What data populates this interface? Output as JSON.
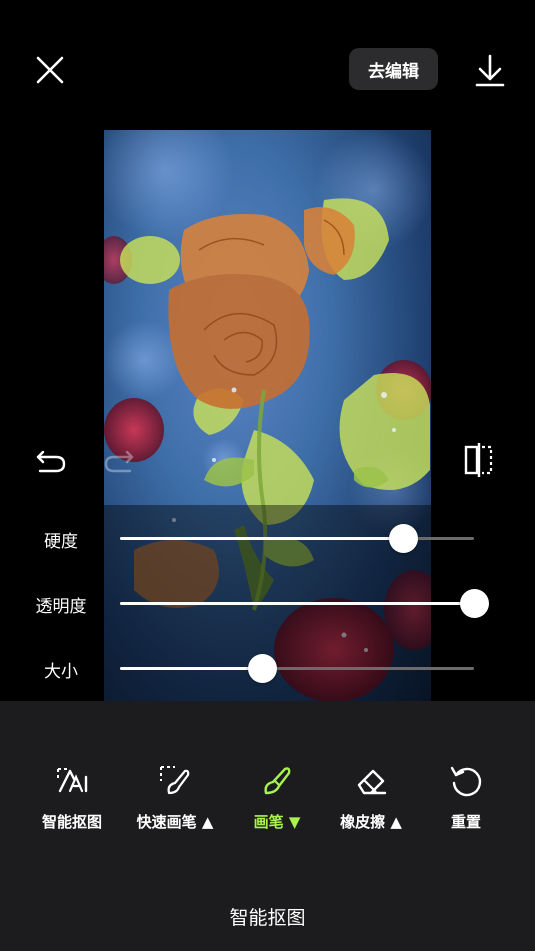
{
  "header": {
    "edit_button_label": "去编辑"
  },
  "icons": {
    "close": "close-icon",
    "download": "download-icon",
    "undo": "undo-icon",
    "redo": "redo-icon",
    "compare": "compare-icon"
  },
  "sliders": [
    {
      "label": "硬度",
      "value": 0.8
    },
    {
      "label": "透明度",
      "value": 1.0
    },
    {
      "label": "大小",
      "value": 0.4
    }
  ],
  "tools": [
    {
      "label": "智能抠图",
      "icon": "smart-cutout-icon",
      "active": false
    },
    {
      "label": "快速画笔 ▲",
      "icon": "quick-brush-icon",
      "active": false
    },
    {
      "label": "画笔 ▼",
      "icon": "brush-icon",
      "active": true
    },
    {
      "label": "橡皮擦 ▲",
      "icon": "eraser-icon",
      "active": false
    },
    {
      "label": "重置",
      "icon": "reset-icon",
      "active": false
    }
  ],
  "mode_title": "智能抠图",
  "colors": {
    "accent": "#a8f34a",
    "selection_overlay": "#c8e05a",
    "panel_bg": "#1c1c1e"
  }
}
